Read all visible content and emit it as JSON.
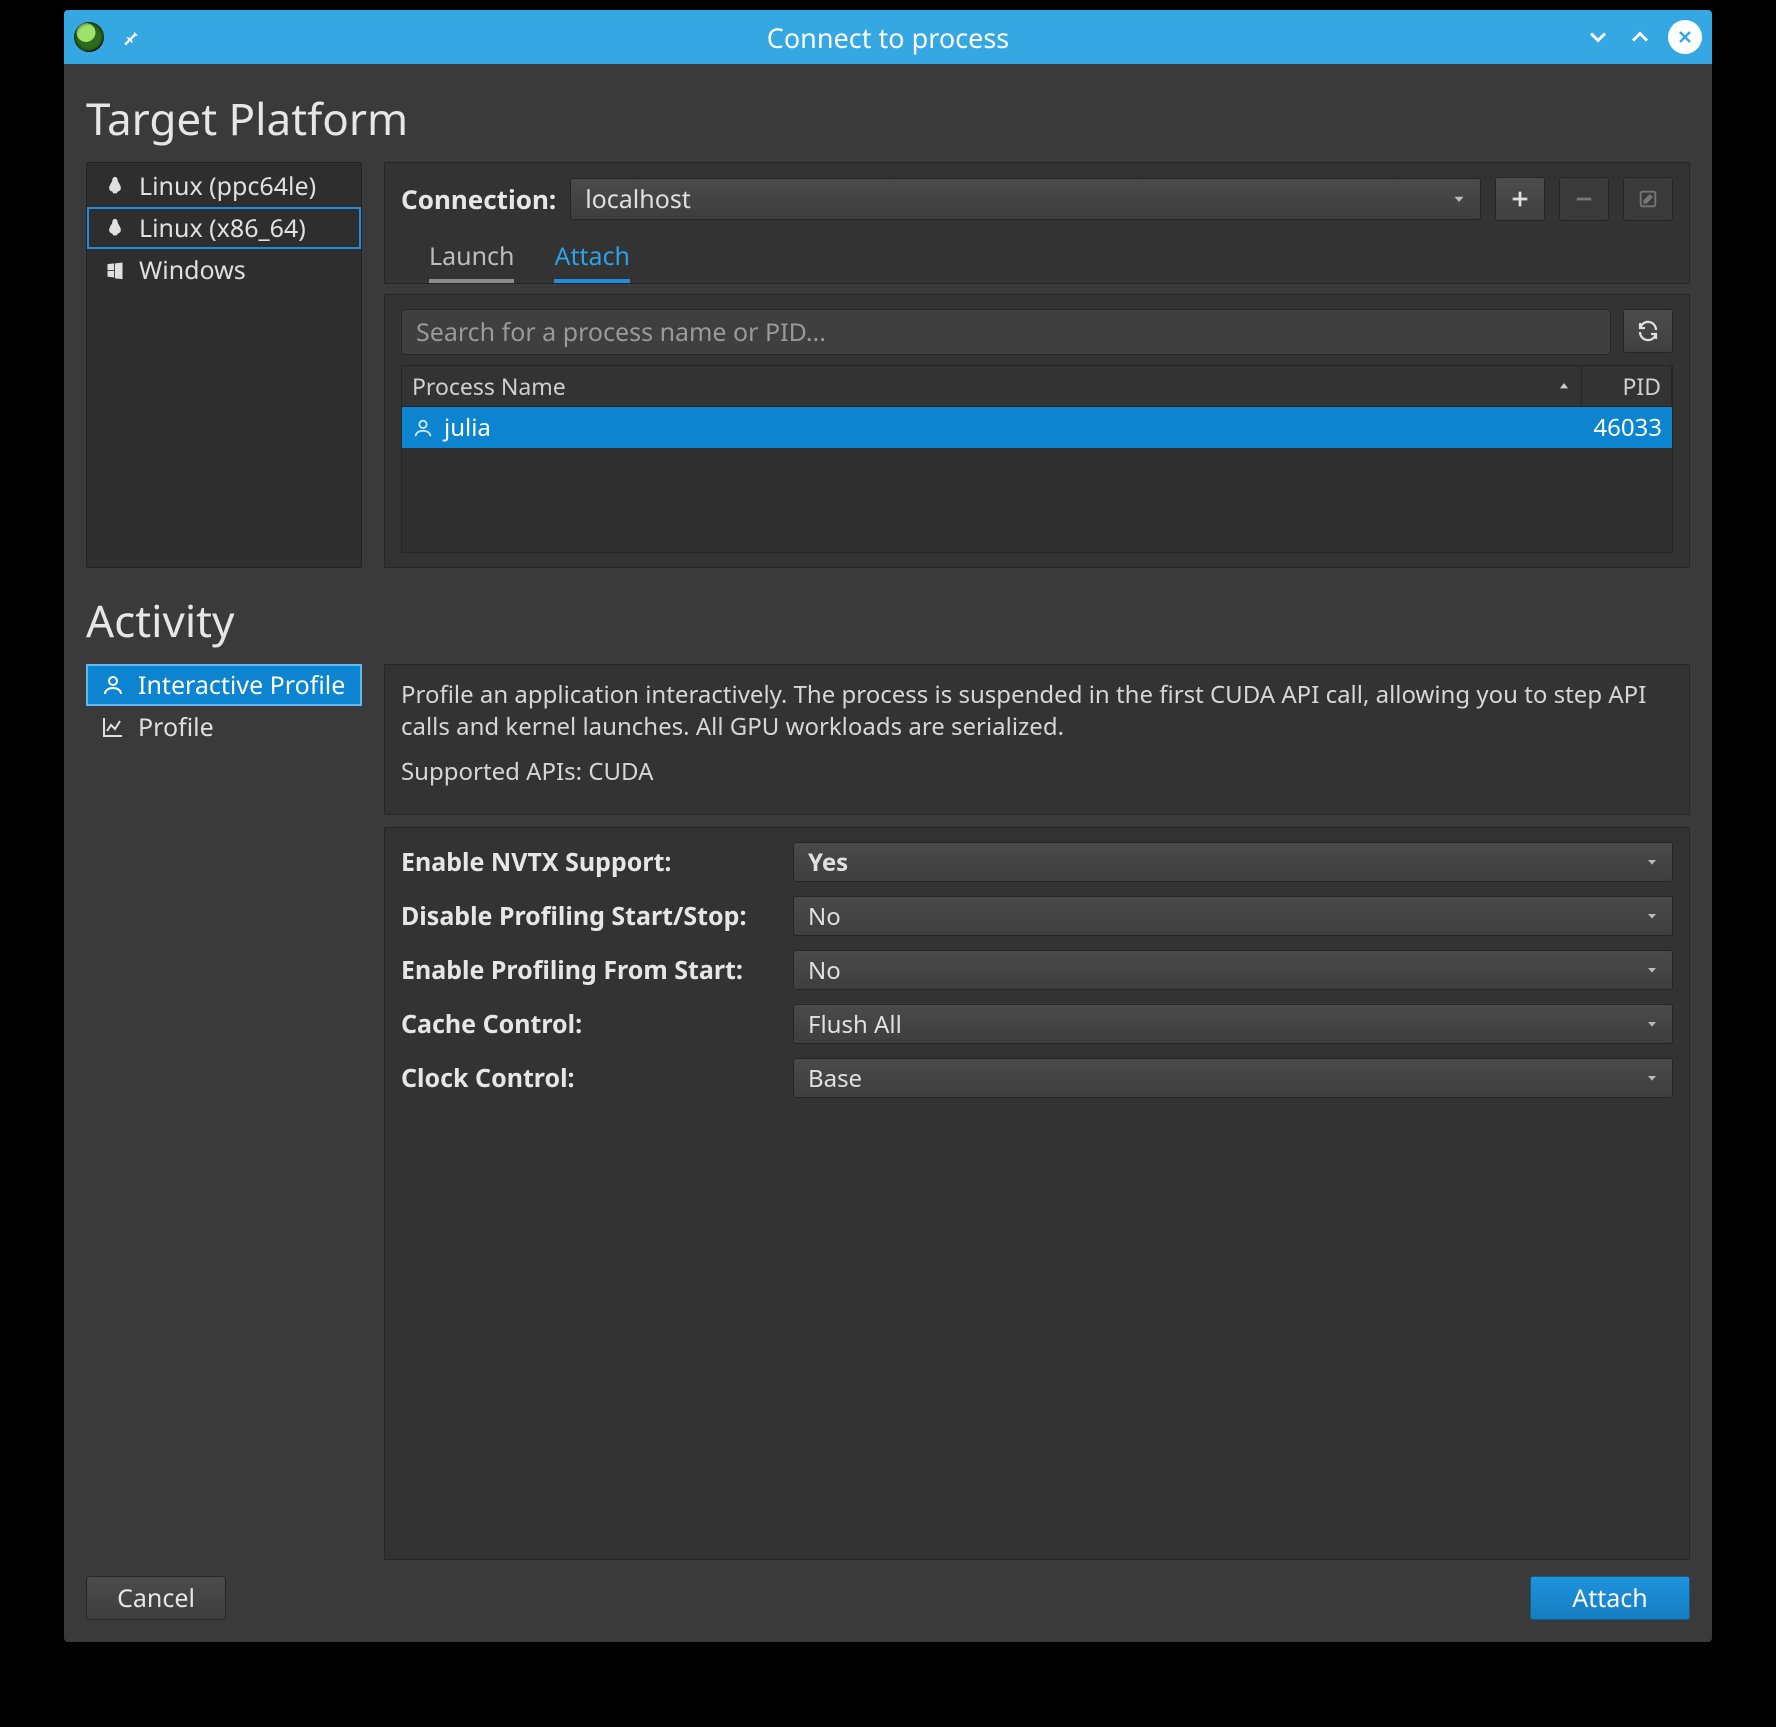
{
  "titlebar": {
    "title": "Connect to process"
  },
  "sections": {
    "target_platform_title": "Target Platform",
    "activity_title": "Activity"
  },
  "platforms": [
    {
      "label": "Linux (ppc64le)",
      "icon": "linux"
    },
    {
      "label": "Linux (x86_64)",
      "icon": "linux",
      "selected": true
    },
    {
      "label": "Windows",
      "icon": "windows"
    }
  ],
  "connection": {
    "label": "Connection:",
    "value": "localhost"
  },
  "tabs": {
    "launch": "Launch",
    "attach": "Attach",
    "active": "attach"
  },
  "search": {
    "placeholder": "Search for a process name or PID..."
  },
  "process_table": {
    "columns": {
      "name": "Process Name",
      "pid": "PID"
    },
    "rows": [
      {
        "name": "julia",
        "pid": "46033"
      }
    ]
  },
  "activities": [
    {
      "label": "Interactive Profile",
      "selected": true
    },
    {
      "label": "Profile"
    }
  ],
  "activity_description": {
    "line1": "Profile an application interactively. The process is suspended in the first CUDA API call, allowing you to step API calls and kernel launches. All GPU workloads are serialized.",
    "line2": "Supported APIs: CUDA"
  },
  "options": [
    {
      "label": "Enable NVTX Support:",
      "value": "Yes",
      "bold": true
    },
    {
      "label": "Disable Profiling Start/Stop:",
      "value": "No"
    },
    {
      "label": "Enable Profiling From Start:",
      "value": "No"
    },
    {
      "label": "Cache Control:",
      "value": "Flush All"
    },
    {
      "label": "Clock Control:",
      "value": "Base"
    }
  ],
  "footer": {
    "cancel": "Cancel",
    "attach": "Attach"
  }
}
